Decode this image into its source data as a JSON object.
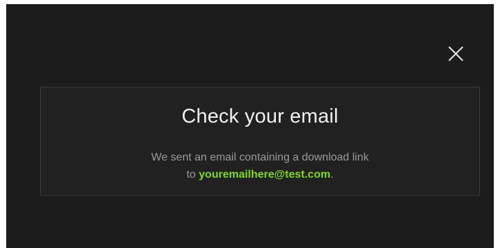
{
  "dialog": {
    "title": "Check your email",
    "message_line1": "We sent an email containing a download link",
    "message_line2_prefix": "to ",
    "email": "youremailhere@test.com",
    "message_line2_suffix": "."
  },
  "close_button": {
    "icon": "close-icon"
  },
  "colors": {
    "overlay_background": "#1c1c1d",
    "dialog_background": "#212122",
    "dialog_border": "#3a3a3c",
    "title_text": "#f2f2f2",
    "body_text": "#9a9a9c",
    "email_accent": "#7fdb12"
  }
}
